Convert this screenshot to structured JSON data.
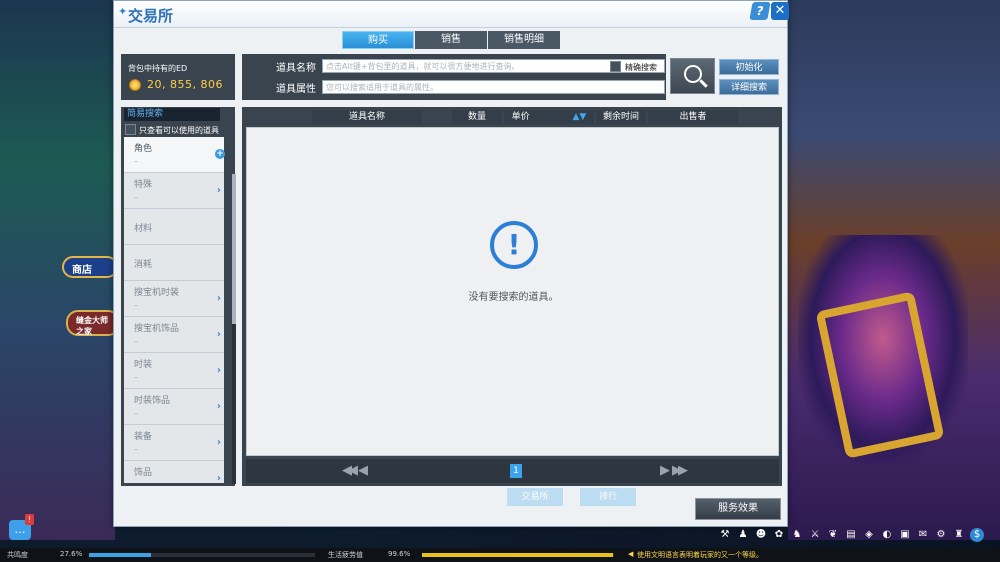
{
  "window": {
    "title": "交易所",
    "help_label": "?",
    "close_label": "✕"
  },
  "tabs": [
    {
      "label": "购买",
      "active": true
    },
    {
      "label": "销售",
      "active": false
    },
    {
      "label": "销售明细",
      "active": false
    }
  ],
  "ed": {
    "label": "背包中持有的ED",
    "value": "20, 855, 806"
  },
  "search": {
    "name_label": "道具名称",
    "name_placeholder": "点击Alt键+背包里的道具，就可以很方便地进行查询。",
    "exact_label": "精确搜索",
    "attr_label": "道具属性",
    "attr_placeholder": "您可以搜索适用于道具的属性。",
    "init_button": "初始化",
    "detail_button": "详细搜索"
  },
  "categories": {
    "title": "简易搜索",
    "usable_only_label": "只查看可以使用的道具",
    "items": [
      {
        "label": "角色",
        "sub": "–"
      },
      {
        "label": "特殊",
        "sub": "–"
      },
      {
        "label": "材料",
        "sub": ""
      },
      {
        "label": "消耗",
        "sub": ""
      },
      {
        "label": "搜宝机时装",
        "sub": "–"
      },
      {
        "label": "搜宝机饰品",
        "sub": "–"
      },
      {
        "label": "时装",
        "sub": "–"
      },
      {
        "label": "时装饰品",
        "sub": "–"
      },
      {
        "label": "装备",
        "sub": "–"
      },
      {
        "label": "饰品",
        "sub": "–"
      }
    ]
  },
  "results": {
    "columns": [
      "道具名称",
      "数量",
      "单价",
      "剩余时间",
      "出售者"
    ],
    "empty_message": "没有要搜索的道具。",
    "current_page": "1"
  },
  "behind": {
    "btn1": "交易所",
    "btn2": "排行"
  },
  "service_button": "服务效果",
  "statusbar": {
    "resonance_label": "共鸣度",
    "resonance_value": "27.6%",
    "resonance_fraction": 0.276,
    "fatigue_label": "生活疲劳值",
    "fatigue_value": "99.6%",
    "fatigue_fraction": 0.996,
    "message": "使用文明语言表明着玩家的又一个等级。"
  },
  "background_signs": {
    "shop": "商店",
    "tailor": "缝金大师之家"
  },
  "colors": {
    "accent": "#2e86d0",
    "ed_value": "#ffd14a",
    "fatigue_fill": "#e8c21a",
    "resonance_fill": "#3aa2e8"
  }
}
